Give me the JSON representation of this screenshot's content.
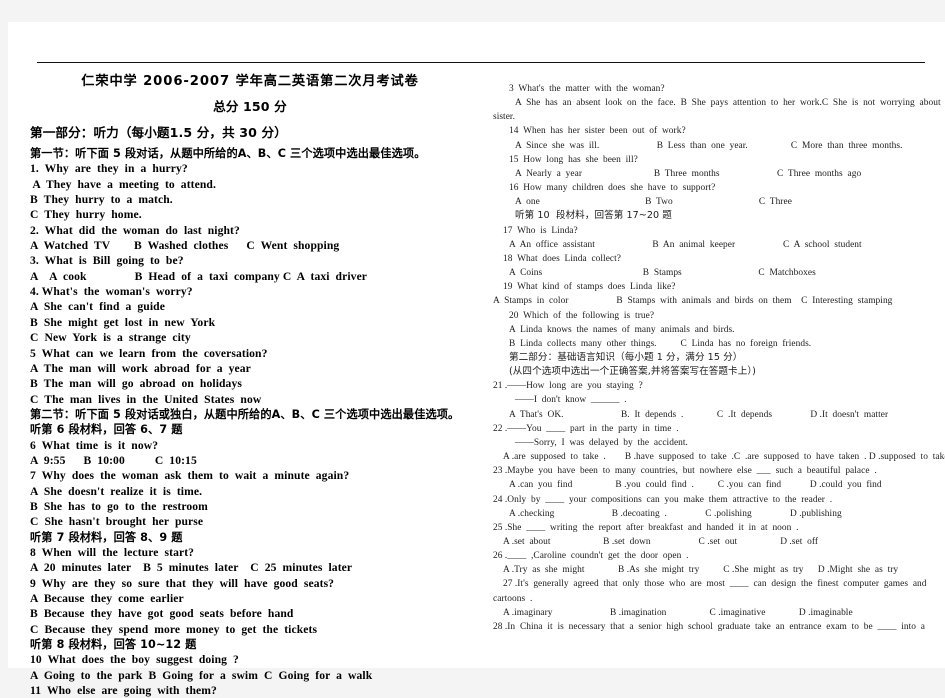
{
  "page": {
    "background": "#f4f4f4",
    "paper": "#ffffff",
    "rule_color": "#111111"
  },
  "header": {
    "school_title": "仁荣中学 2006-2007 学年高二英语第二次月考试卷",
    "total_score": "总分 150 分"
  },
  "left_column": {
    "part_one_heading": "第一部分：听力（每小题1.5 分，共 30 分）",
    "section_one_heading": "第一节：听下面 5 段对话，从题中所给的A、B、C 三个选项中选出最佳选项。",
    "section_two_heading": "第二节：听下面 5 段对话或独白，从题中所给的A、B、C 三个选项中选出最佳选项。",
    "material6_heading": "听第 6 段材料，回答 6、7 题",
    "material7_heading": "听第 7 段材料，回答 8、9 题",
    "material8_heading": "听第 8 段材料，回答 10~12 题",
    "lines": [
      "1.  Why  are  they  in  a  hurry?",
      " A  They  have  a  meeting  to  attend.",
      "B  They  hurry  to  a  match.",
      "C  They  hurry  home.",
      "2.  What  did  the  woman  do  last  night?",
      "A  Watched  TV        B  Washed  clothes      C  Went  shopping",
      "3.  What  is  Bill  going  to  be?",
      "A    A  cook                B  Head  of  a  taxi  company C  A  taxi  driver",
      "4. What's  the  woman's  worry?",
      "A  She  can't  find  a  guide",
      "B  She  might  get  lost  in  new  York",
      "C  New  York  is  a  strange  city",
      "5  What  can  we  learn  from  the  coversation?",
      "A  The  man  will  work  abroad  for  a  year",
      "B  The  man  will  go  abroad  on  holidays",
      "C  The  man  lives  in  the  United  States  now"
    ],
    "lines_after_sec2": [
      "6  What  time  is  it  now?",
      "A  9:55      B  10:00          C  10:15",
      "7  Why  does  the  woman  ask  them  to  wait  a  minute  again?",
      "A  She  doesn't  realize  it  is  time.",
      "B  She  has  to  go  to  the  restroom",
      "C  She  hasn't  brought  her  purse"
    ],
    "lines_after_m7": [
      "8  When  will  the  lecture  start?",
      "A  20  minutes  later    B  5  minutes  later    C  25  minutes  later",
      "9  Why  are  they  so  sure  that  they  will  have  good  seats?",
      "A  Because  they  come  earlier",
      "B  Because  they  have  got  good  seats  before  hand",
      "C  Because  they  spend  more  money  to  get  the  tickets"
    ],
    "lines_after_m8": [
      "10  What  does  the  boy  suggest  doing  ?",
      "A  Going  to  the  park  B  Going  for  a  swim  C  Going  for  a  walk",
      "11  Who  else  are  going  with  them?"
    ]
  },
  "right_column": {
    "part_two_heading": "第二部分：基础语言知识（每小题 1 分，满分 15 分）",
    "part_two_subheading": "(从四个选项中选出一个正确答案,并将答案写在答题卡上）)",
    "material10_heading": "听第 10  段材料，回答第 17~20 题",
    "lines": [
      {
        "t": "3  What's  the  matter  with  the  woman?",
        "i": "ind2"
      },
      {
        "t": "A  She  has  an  absent  look  on  the  face.  B  She  pays  attention  to  her  work.C  She  is  not  worrying  about  her",
        "i": "ind3"
      },
      {
        "t": "sister.",
        "i": "ind0"
      },
      {
        "t": "14  When  has  her  sister  been  out  of  work?",
        "i": "ind2"
      },
      {
        "t": "A  Since  she  was  ill.                        B  Less  than  one  year.                  C  More  than  three  months.",
        "i": "ind3"
      },
      {
        "t": "15  How  long  has  she  been  ill?",
        "i": "ind2"
      },
      {
        "t": "A  Nearly  a  year                              B  Three  months                        C  Three  months  ago",
        "i": "ind3"
      },
      {
        "t": "16  How  many  children  does  she  have  to  support?",
        "i": "ind2"
      },
      {
        "t": "A  one                                            B  Two                                    C  Three",
        "i": "ind3"
      }
    ],
    "lines_after_m10": [
      {
        "t": "17  Who  is  Linda?",
        "i": "ind1"
      },
      {
        "t": "A  An  office  assistant                        B  An  animal  keeper                    C  A  school  student",
        "i": "ind2"
      },
      {
        "t": "18  What  does  Linda  collect?",
        "i": "ind1"
      },
      {
        "t": "A  Coins                                          B  Stamps                                C  Matchboxes",
        "i": "ind2"
      },
      {
        "t": "19  What  kind  of  stamps  does  Linda  like?",
        "i": "ind1"
      },
      {
        "t": "A  Stamps  in  color                    B  Stamps  with  animals  and  birds  on  them    C  Interesting  stamping",
        "i": "ind0"
      },
      {
        "t": "20  Which  of  the  following  is  true?",
        "i": "ind2"
      },
      {
        "t": "A  Linda  knows  the  names  of  many  animals  and  birds.",
        "i": "ind2"
      },
      {
        "t": "B  Linda  collects  many  other  things.          C  Linda  has  no  foreign  friends.",
        "i": "ind2"
      }
    ],
    "lines_after_part2": [
      {
        "t": "21 .——How  long  are  you  staying  ?",
        "i": "ind0"
      },
      {
        "t": "——I  don't  know  ______  .",
        "i": "ind3"
      },
      {
        "t": "A  That's  OK.                        B.  It  depends  .              C  .It  depends                D .It  doesn't  matter",
        "i": "ind2"
      },
      {
        "t": "22 .——You  ____  part  in  the  party  in  time  .",
        "i": "ind0"
      },
      {
        "t": "——Sorry,  I  was  delayed  by  the  accident.",
        "i": "ind3"
      },
      {
        "t": "A .are  supposed  to  take  .        B .have  supposed  to  take  .C  .are  supposed  to  have  taken  . D .supposed  to  take",
        "i": "ind1"
      },
      {
        "t": "23 .Maybe  you  have  been  to  many  countries,  but  nowhere  else  ___  such  a  beautiful  palace  .",
        "i": "ind0"
      },
      {
        "t": "A .can  you  find                  B .you  could  find  .          C .you  can  find            D .could  you  find",
        "i": "ind2"
      },
      {
        "t": "24 .Only  by  ____  your  compositions  can  you  make  them  attractive  to  the  reader  .",
        "i": "ind0"
      },
      {
        "t": "A .checking                        B .decoating  .                C .polishing                D .publishing",
        "i": "ind2"
      },
      {
        "t": "25 .She  ____  writing  the  report  after  breakfast  and  handed  it  in  at  noon  .",
        "i": "ind0"
      },
      {
        "t": "A .set  about                      B .set  down                    C .set  out                  D .set  off",
        "i": "ind1"
      },
      {
        "t": "26 .____  ,Caroline  coundn't  get  the  door  open  .",
        "i": "ind0"
      },
      {
        "t": "A .Try  as  she  might              B .As  she  might  try          C .She  might  as  try      D .Might  she  as  try",
        "i": "ind1"
      },
      {
        "t": "27 .It's  generally  agreed  that  only  those  who  are  most  ____  can  design  the  finest  computer  games  and",
        "i": "ind1"
      },
      {
        "t": "cartoons  .",
        "i": "ind0"
      },
      {
        "t": "A .imaginary                        B .imagination                  C .imaginative              D .imaginable",
        "i": "ind1"
      },
      {
        "t": "28 .In  China  it  is  necessary  that  a  senior  high  school  graduate  take  an  entrance  exam  to  be  ____  into  a",
        "i": "ind0"
      }
    ]
  }
}
